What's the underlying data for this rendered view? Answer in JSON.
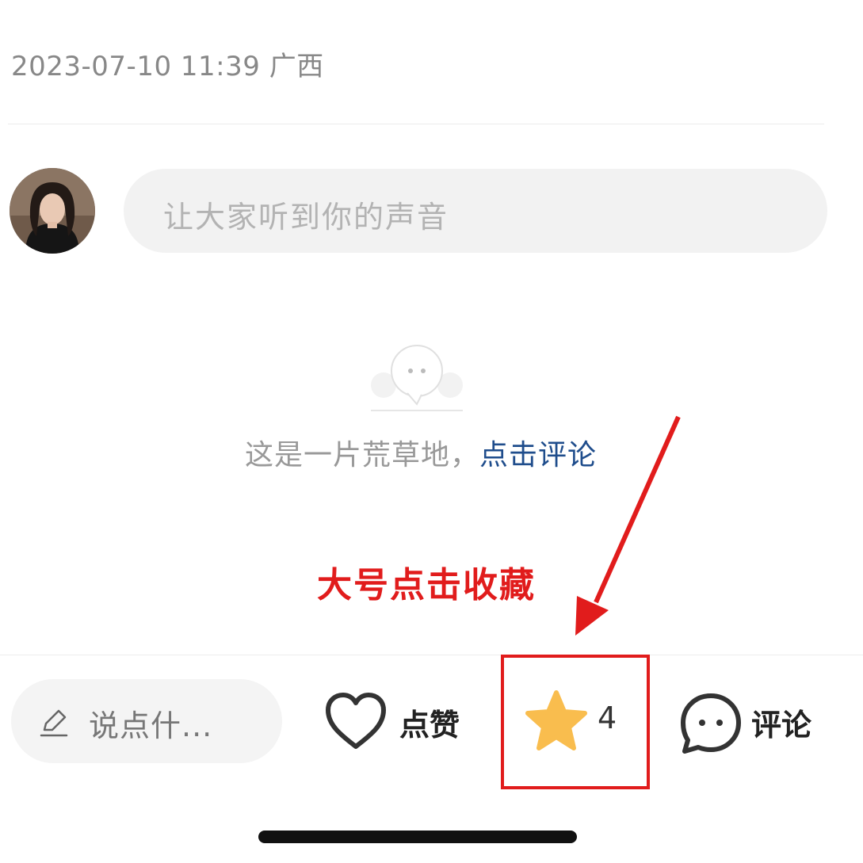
{
  "post": {
    "timestamp": "2023-07-10 11:39",
    "location": "广西"
  },
  "comment_input": {
    "placeholder": "让大家听到你的声音"
  },
  "empty_state": {
    "message": "这是一片荒草地，",
    "cta": "点击评论"
  },
  "annotation": {
    "text": "大号点击收藏"
  },
  "bottom_bar": {
    "say_label": "说点什...",
    "like_label": "点赞",
    "favorite_count": "4",
    "comment_label": "评论"
  },
  "colors": {
    "accent_link": "#1f4d8c",
    "annotation_red": "#e11c1c",
    "star": "#f9bd4e"
  },
  "icons": [
    "pencil-icon",
    "heart-icon",
    "star-icon",
    "comment-bubble-icon",
    "chat-bubble-illustration"
  ]
}
